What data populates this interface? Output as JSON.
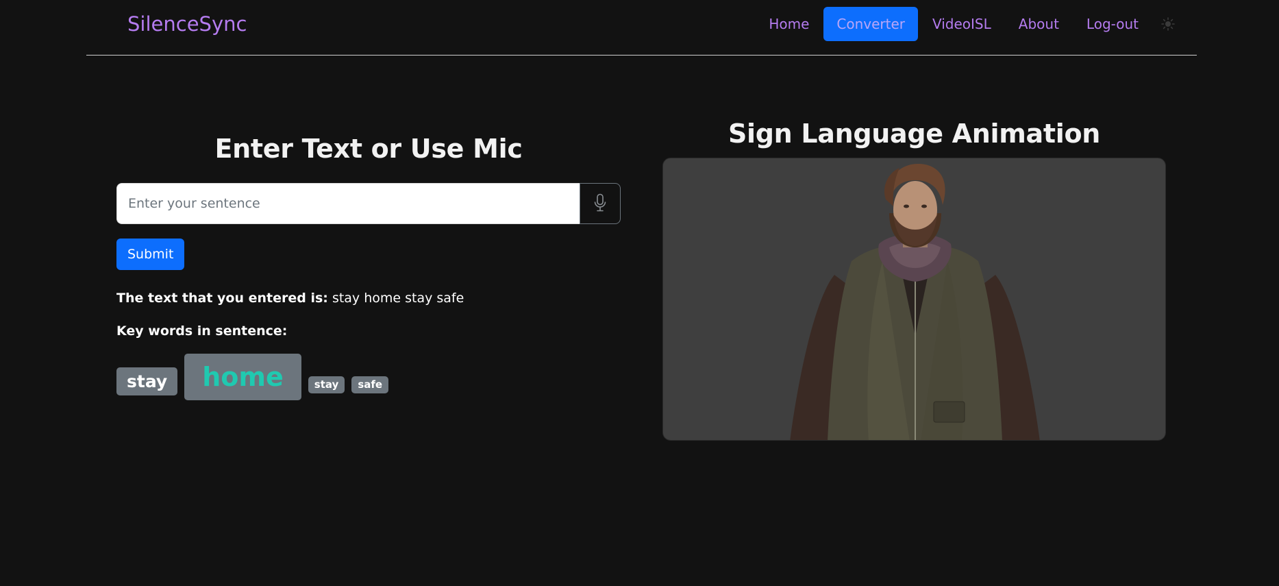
{
  "navbar": {
    "brand": "SilenceSync",
    "links": [
      {
        "label": "Home",
        "active": false
      },
      {
        "label": "Converter",
        "active": true
      },
      {
        "label": "VideoISL",
        "active": false
      },
      {
        "label": "About",
        "active": false
      },
      {
        "label": "Log-out",
        "active": false
      }
    ],
    "theme_icon": "sun-icon"
  },
  "converter": {
    "title": "Enter Text or Use Mic",
    "input_placeholder": "Enter your sentence",
    "input_value": "",
    "mic_icon": "microphone-icon",
    "submit_label": "Submit",
    "entered_label": "The text that you entered is:",
    "entered_text": "stay home stay safe",
    "keywords_label": "Key words in sentence:",
    "keywords": [
      "stay",
      "home",
      "stay",
      "safe"
    ]
  },
  "animation": {
    "title": "Sign Language Animation"
  },
  "colors": {
    "background": "#121212",
    "brand": "#b57cf0",
    "primary": "#0d6efd",
    "badge": "#6c757d",
    "highlight": "#20c9b0",
    "panel": "#3f3f3f"
  }
}
